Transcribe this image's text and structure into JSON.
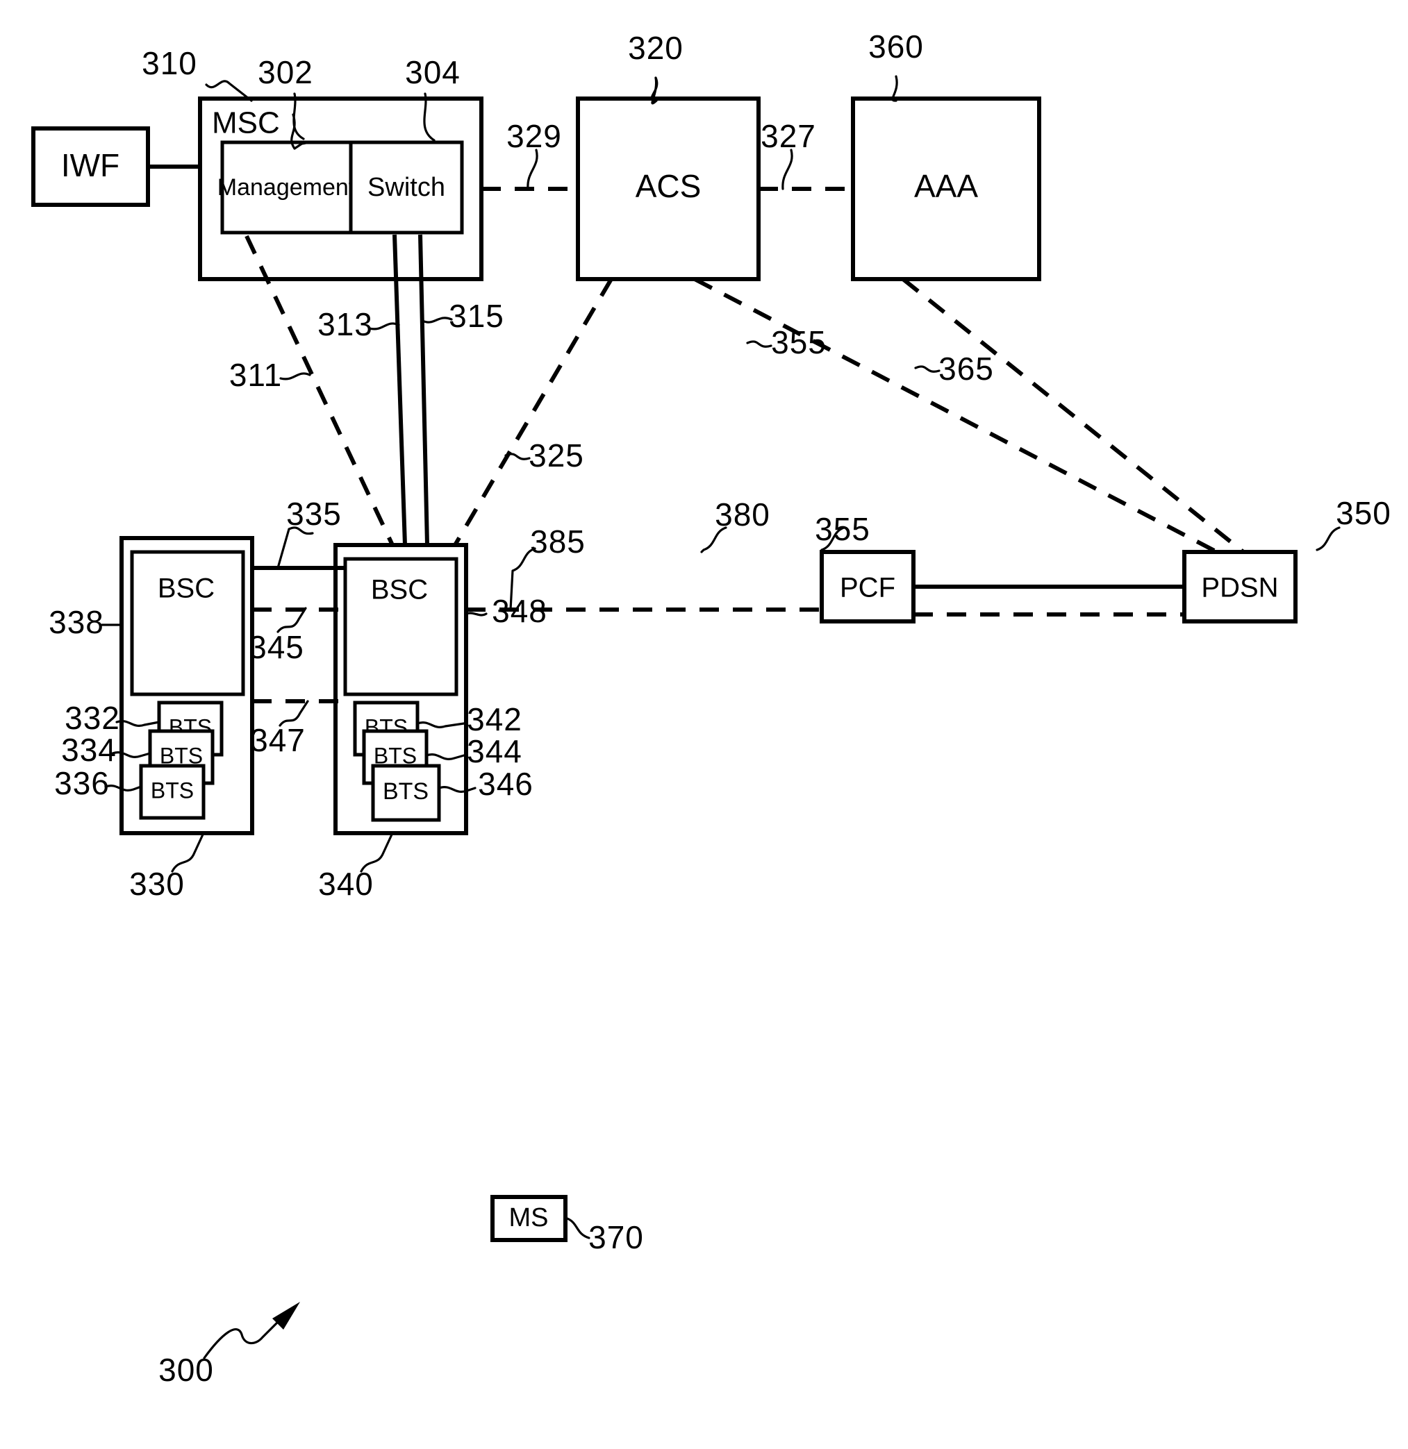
{
  "figure": {
    "id": "300",
    "type": "patent-block-diagram",
    "description": "Wireless network block diagram showing MSC, ACS, AAA, BSC, BTS, PCF, PDSN, IWF and MS nodes"
  },
  "nodes": {
    "iwf": {
      "label": "IWF",
      "ref": ""
    },
    "msc": {
      "label": "MSC",
      "ref": "310"
    },
    "management": {
      "label": "Management",
      "ref": "302"
    },
    "switch": {
      "label": "Switch",
      "ref": "304"
    },
    "acs": {
      "label": "ACS",
      "ref": "320"
    },
    "aaa": {
      "label": "AAA",
      "ref": "360"
    },
    "bsc_left": {
      "label": "BSC",
      "ref": "338"
    },
    "bsc_right": {
      "label": "BSC",
      "ref": "348"
    },
    "bsc_group_left": {
      "ref": "330"
    },
    "bsc_group_right": {
      "ref": "340"
    },
    "bts_left_1": {
      "label": "BTS",
      "ref": "332"
    },
    "bts_left_2": {
      "label": "BTS",
      "ref": "334"
    },
    "bts_left_3": {
      "label": "BTS",
      "ref": "336"
    },
    "bts_right_1": {
      "label": "BTS",
      "ref": "342"
    },
    "bts_right_2": {
      "label": "BTS",
      "ref": "344"
    },
    "bts_right_3": {
      "label": "BTS",
      "ref": "346"
    },
    "pcf": {
      "label": "PCF",
      "ref": "380"
    },
    "pdsn": {
      "label": "PDSN",
      "ref": "350"
    },
    "ms": {
      "label": "MS",
      "ref": "370"
    }
  },
  "links": [
    {
      "ref": "329",
      "from": "msc",
      "to": "acs",
      "style": "dashed"
    },
    {
      "ref": "327",
      "from": "acs",
      "to": "aaa",
      "style": "dashed"
    },
    {
      "ref": "311",
      "from": "management",
      "to": "bsc_right_group",
      "style": "dashed"
    },
    {
      "ref": "313",
      "from": "switch",
      "to": "bsc_right_group",
      "style": "solid"
    },
    {
      "ref": "315",
      "from": "switch",
      "to": "bsc_right_group",
      "style": "solid"
    },
    {
      "ref": "325",
      "from": "acs",
      "to": "bsc_right_group",
      "style": "dashed"
    },
    {
      "ref": "335",
      "from": "bsc_left",
      "to": "bsc_right",
      "style": "solid"
    },
    {
      "ref": "345",
      "from": "bsc_left",
      "to": "bsc_right",
      "style": "dashed"
    },
    {
      "ref": "347",
      "from": "bsc_left",
      "to": "bsc_right",
      "style": "dashed"
    },
    {
      "ref": "385",
      "from": "bsc_right",
      "to": "pcf",
      "style": "dashed"
    },
    {
      "ref": "355",
      "from": "pcf",
      "to": "pdsn",
      "style": "solid"
    },
    {
      "ref": "355",
      "from": "acs",
      "to": "pdsn",
      "style": "dashed"
    },
    {
      "ref": "365",
      "from": "aaa",
      "to": "pdsn",
      "style": "dashed"
    }
  ],
  "ref_labels": [
    {
      "id": "310",
      "text": "310"
    },
    {
      "id": "302",
      "text": "302"
    },
    {
      "id": "304",
      "text": "304"
    },
    {
      "id": "320",
      "text": "320"
    },
    {
      "id": "360",
      "text": "360"
    },
    {
      "id": "329",
      "text": "329"
    },
    {
      "id": "327",
      "text": "327"
    },
    {
      "id": "311",
      "text": "311"
    },
    {
      "id": "313",
      "text": "313"
    },
    {
      "id": "315",
      "text": "315"
    },
    {
      "id": "325",
      "text": "325"
    },
    {
      "id": "355a",
      "text": "355"
    },
    {
      "id": "355b",
      "text": "355"
    },
    {
      "id": "365",
      "text": "365"
    },
    {
      "id": "335",
      "text": "335"
    },
    {
      "id": "345",
      "text": "345"
    },
    {
      "id": "347",
      "text": "347"
    },
    {
      "id": "338",
      "text": "338"
    },
    {
      "id": "348",
      "text": "348"
    },
    {
      "id": "385",
      "text": "385"
    },
    {
      "id": "380",
      "text": "380"
    },
    {
      "id": "350",
      "text": "350"
    },
    {
      "id": "332",
      "text": "332"
    },
    {
      "id": "334",
      "text": "334"
    },
    {
      "id": "336",
      "text": "336"
    },
    {
      "id": "342",
      "text": "342"
    },
    {
      "id": "344",
      "text": "344"
    },
    {
      "id": "346",
      "text": "346"
    },
    {
      "id": "330",
      "text": "330"
    },
    {
      "id": "340",
      "text": "340"
    },
    {
      "id": "370",
      "text": "370"
    },
    {
      "id": "300",
      "text": "300"
    }
  ],
  "colors": {
    "ink": "#000000",
    "paper": "#ffffff"
  }
}
